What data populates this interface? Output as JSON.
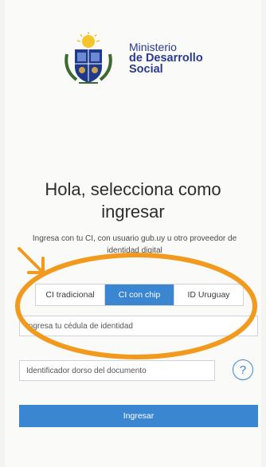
{
  "header": {
    "org_line1": "Ministerio",
    "org_line2": "de Desarrollo",
    "org_line3": "Social"
  },
  "main": {
    "title_line1": "Hola, selecciona como",
    "title_line2": "ingresar",
    "subtitle": "Ingresa con tu CI, con usuario gub.uy u otro proveedor de identidad digital"
  },
  "tabs": [
    {
      "label": "CI tradicional",
      "active": false
    },
    {
      "label": "CI con chip",
      "active": true
    },
    {
      "label": "ID Uruguay",
      "active": false
    }
  ],
  "form": {
    "cedula_placeholder": "Ingresa tu cédula de identidad",
    "document_id_placeholder": "Identificador dorso del documento",
    "help_symbol": "?",
    "submit_label": "Ingresar"
  },
  "colors": {
    "brand_blue": "#2a3a93",
    "accent_blue": "#3b86d1",
    "annotation_orange": "#f29a1e"
  },
  "icons": [
    "coat-of-arms-icon",
    "help-icon",
    "annotation-arrow-icon"
  ]
}
